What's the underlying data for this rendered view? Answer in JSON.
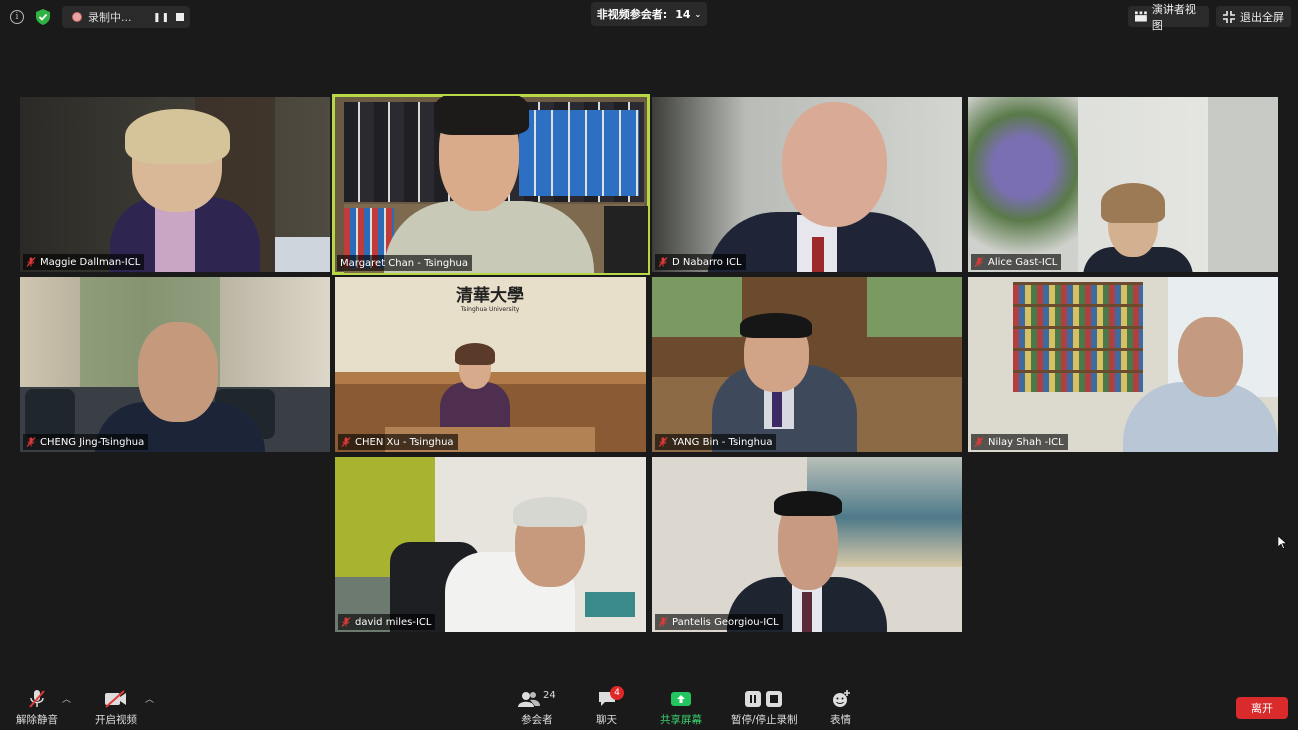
{
  "topbar": {
    "recording_label": "录制中...",
    "nonvideo_label": "非视频参会者:",
    "nonvideo_count": "14",
    "speaker_view_label": "演讲者视图",
    "exit_fullscreen_label": "退出全屏"
  },
  "tiles": [
    {
      "name": "Maggie Dallman-ICL"
    },
    {
      "name": "Margaret Chan - Tsinghua"
    },
    {
      "name": "D Nabarro ICL"
    },
    {
      "name": "Alice Gast-ICL"
    },
    {
      "name": "CHENG Jing-Tsinghua"
    },
    {
      "name": "CHEN Xu - Tsinghua"
    },
    {
      "name": "YANG Bin - Tsinghua"
    },
    {
      "name": "Nilay Shah -ICL"
    },
    {
      "name": "david miles-ICL"
    },
    {
      "name": "Pantelis Georgiou-ICL"
    }
  ],
  "tsinghua_sign": {
    "cn": "清華大學",
    "en": "Tsinghua University"
  },
  "toolbar": {
    "unmute_label": "解除静音",
    "start_video_label": "开启视频",
    "participants_label": "参会者",
    "participants_count": "24",
    "chat_label": "聊天",
    "chat_badge": "4",
    "share_label": "共享屏幕",
    "record_label": "暂停/停止录制",
    "reactions_label": "表情",
    "leave_label": "离开"
  },
  "colors": {
    "background": "#1a1a1a",
    "active_speaker": "#b7d844",
    "share_green": "#22c55e",
    "leave_red": "#d92b2b",
    "mute_red": "#e03a3a"
  }
}
